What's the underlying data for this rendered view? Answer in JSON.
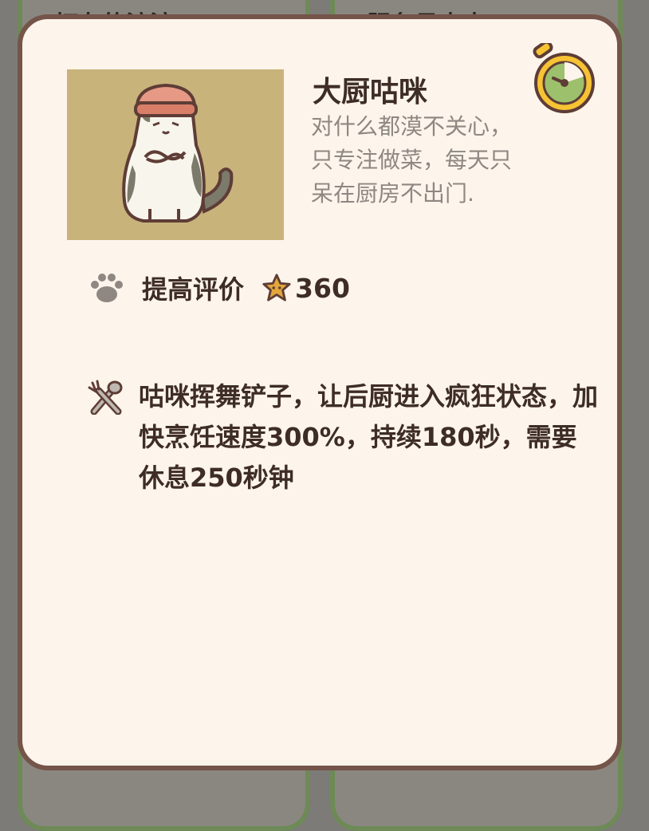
{
  "background": {
    "left_card_title": "打杂的渡渡",
    "right_card_title": "服务员吉吉"
  },
  "dialog": {
    "name": "大厨咕咪",
    "description": "对什么都漠不关心，只专注做菜，每天只呆在厨房不出门.",
    "portrait_icon": "chef-cat-portrait",
    "timer_icon": "stopwatch-icon",
    "rating": {
      "icon": "paw-icon",
      "label": "提高评价",
      "star_icon": "star-icon",
      "value": "360"
    },
    "skill": {
      "icon": "spatula-fork-icon",
      "text": "咕咪挥舞铲子，让后厨进入疯狂状态，加快烹饪速度300%，持续180秒，需要休息250秒钟"
    }
  },
  "colors": {
    "dialog_bg": "#fdf5eb",
    "dialog_border": "#75544a",
    "text_dark": "#3e2c27",
    "text_gray": "#8e8782",
    "portrait_bg": "#c8b37b",
    "timer_yellow": "#f6c334",
    "timer_green": "#9dc06d"
  }
}
